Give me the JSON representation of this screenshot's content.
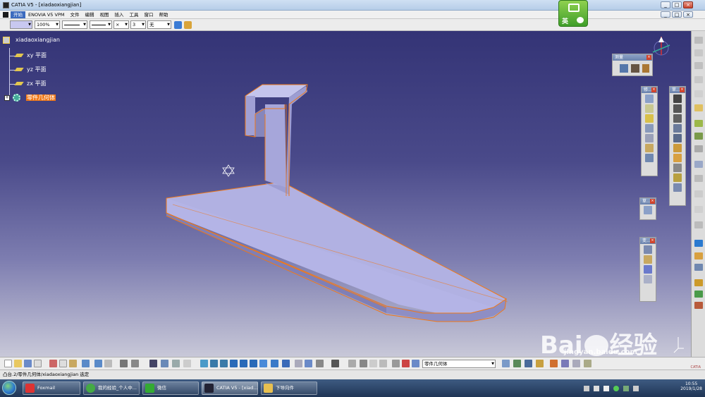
{
  "window": {
    "title": "CATIA V5 - [xiadaoxiangjian]",
    "controls": [
      "minimize-icon",
      "restore-icon",
      "close-icon"
    ],
    "inner_controls": [
      "minimize-icon",
      "restore-icon",
      "close-icon"
    ]
  },
  "menu": {
    "items": [
      "开始",
      "ENOVIA V5 VPM",
      "文件",
      "编辑",
      "视图",
      "插入",
      "工具",
      "窗口",
      "帮助"
    ]
  },
  "properties": {
    "zoom": "100%",
    "layer": "无",
    "thickness": "3",
    "cross": "×"
  },
  "ime": {
    "label": "英"
  },
  "tree": {
    "root": "xiadaoxiangjian",
    "nodes": [
      "xy 平面",
      "yz 平面",
      "zx 平面"
    ],
    "selected": "零件几何体"
  },
  "toolbars": {
    "measure": {
      "title": "测量"
    },
    "features": {
      "title": "修..."
    },
    "sketch": {
      "title": "草..."
    },
    "transform": {
      "title": "变..."
    }
  },
  "bottom": {
    "body_select": "零件几何体"
  },
  "status": "凸台.2/零件几何体/xiadaoxiangjian 选定",
  "taskbar": {
    "tasks": [
      "Foxmail",
      "我的经验_个人中...",
      "微信",
      "CATIA V5 - [xiad...",
      "下导向件"
    ],
    "time": "10:55",
    "date": "2019/1/28"
  },
  "watermark": {
    "brand": "Bai",
    "cn": "经验",
    "url": "jingyan.baidu.com"
  },
  "colors": {
    "viewport_top": "#343476",
    "viewport_bottom": "#c8c8d8",
    "model": "#a9a9df",
    "edge": "#f07818",
    "selection": "#f07818"
  }
}
